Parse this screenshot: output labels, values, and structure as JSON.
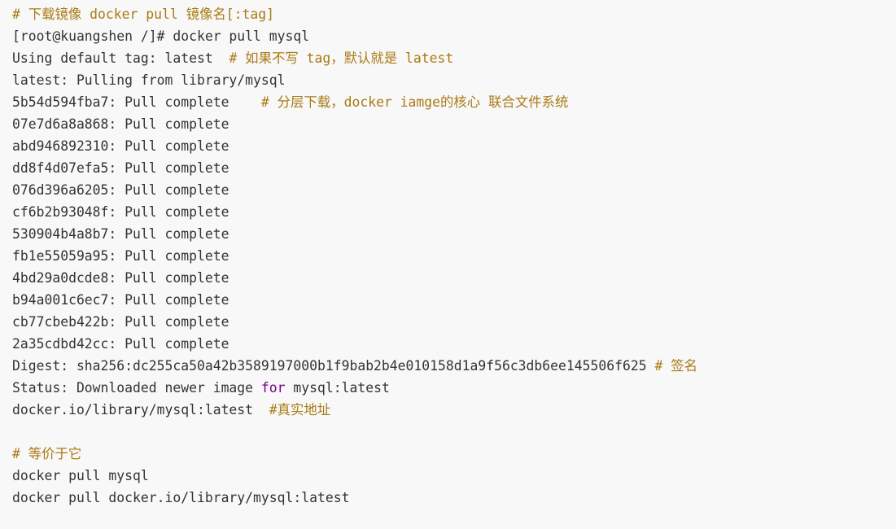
{
  "colors": {
    "background": "#f8f8f8",
    "text": "#333333",
    "comment": "#aa7a14",
    "keyword": "#770088"
  },
  "code": {
    "l01": {
      "comment": "# 下载镜像 docker pull 镜像名[:tag]"
    },
    "l02": {
      "text": "[root@kuangshen /]# docker pull mysql"
    },
    "l03": {
      "text": "Using default tag: latest  ",
      "comment": "# 如果不写 tag，默认就是 latest"
    },
    "l04": {
      "text": "latest: Pulling from library/mysql"
    },
    "l05": {
      "text": "5b54d594fba7: Pull complete    ",
      "comment": "# 分层下载，docker iamge的核心 联合文件系统"
    },
    "l06": {
      "text": "07e7d6a8a868: Pull complete"
    },
    "l07": {
      "text": "abd946892310: Pull complete"
    },
    "l08": {
      "text": "dd8f4d07efa5: Pull complete"
    },
    "l09": {
      "text": "076d396a6205: Pull complete"
    },
    "l10": {
      "text": "cf6b2b93048f: Pull complete"
    },
    "l11": {
      "text": "530904b4a8b7: Pull complete"
    },
    "l12": {
      "text": "fb1e55059a95: Pull complete"
    },
    "l13": {
      "text": "4bd29a0dcde8: Pull complete"
    },
    "l14": {
      "text": "b94a001c6ec7: Pull complete"
    },
    "l15": {
      "text": "cb77cbeb422b: Pull complete"
    },
    "l16": {
      "text": "2a35cdbd42cc: Pull complete"
    },
    "l17": {
      "text": "Digest: sha256:dc255ca50a42b3589197000b1f9bab2b4e010158d1a9f56c3db6ee145506f625 ",
      "comment": "# 签名"
    },
    "l18": {
      "text_before": "Status: Downloaded newer image ",
      "keyword": "for",
      "text_after": " mysql:latest"
    },
    "l19": {
      "text": "docker.io/library/mysql:latest  ",
      "comment": "#真实地址"
    },
    "l20": {
      "text": ""
    },
    "l21": {
      "comment": "# 等价于它"
    },
    "l22": {
      "text": "docker pull mysql"
    },
    "l23": {
      "text": "docker pull docker.io/library/mysql:latest"
    }
  }
}
